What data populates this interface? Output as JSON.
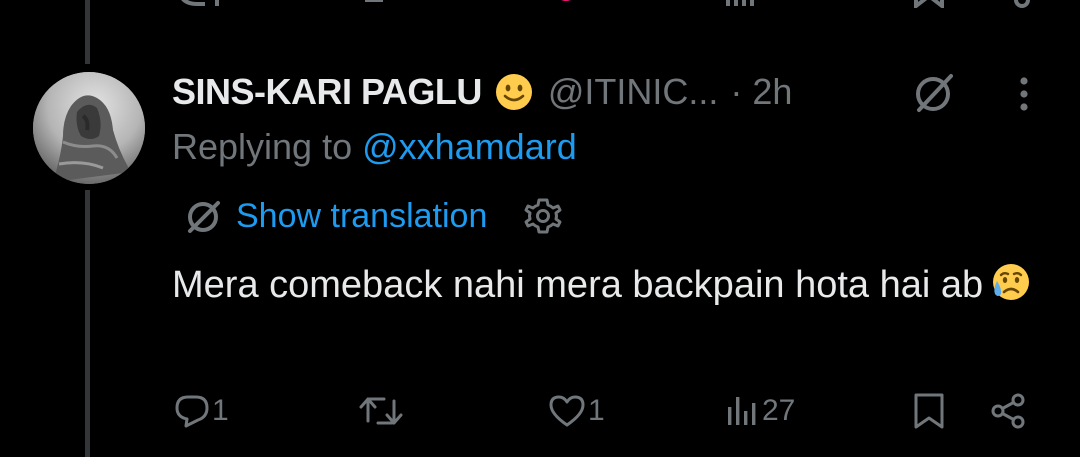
{
  "tweet": {
    "display_name": "SINS-KARI PAGLU",
    "name_emoji": "🙂",
    "handle": "@ITINIC...",
    "time": "· 2h",
    "replying_prefix": "Replying to ",
    "replying_to": "@xxhamdard",
    "translation_label": "Show translation",
    "text": "Mera comeback nahi mera backpain hota hai ab",
    "text_emoji": "😥"
  },
  "actions": {
    "reply_count": "1",
    "retweet_count": "",
    "like_count": "1",
    "views_count": "27"
  },
  "icons": {
    "reply": "reply-icon",
    "retweet": "retweet-icon",
    "like": "heart-icon",
    "views": "views-icon",
    "bookmark": "bookmark-icon",
    "share": "share-icon",
    "grok": "grok-icon",
    "more": "more-icon",
    "gear": "gear-icon"
  },
  "colors": {
    "background": "#000000",
    "text": "#e7e9ea",
    "muted": "#71767b",
    "link": "#1d9bf0",
    "thread_line": "#333639",
    "like_pink": "#f91880"
  }
}
